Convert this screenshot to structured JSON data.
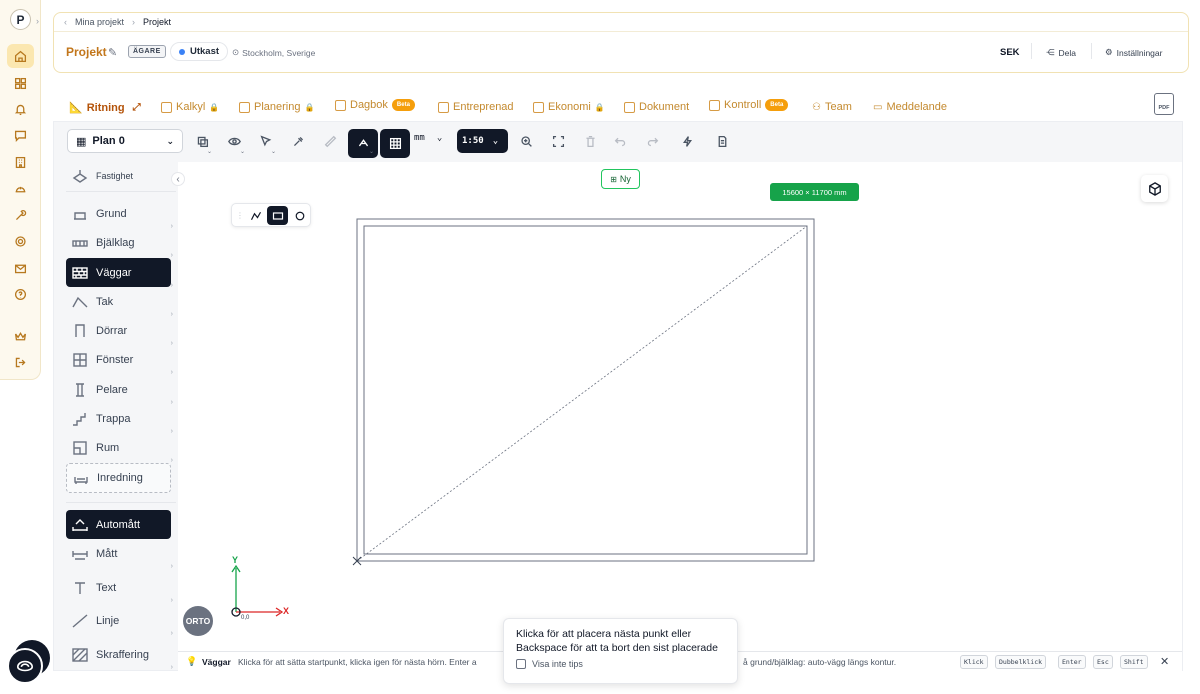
{
  "breadcrumb": {
    "back": "Mina projekt",
    "current": "Projekt"
  },
  "project": {
    "title": "Projekt",
    "owner_badge": "ÄGARE",
    "status": "Utkast",
    "location": "Stockholm, Sverige",
    "currency": "SEK",
    "share_label": "Dela",
    "settings_label": "Inställningar"
  },
  "tabs": [
    {
      "label": "Ritning",
      "active": true
    },
    {
      "label": "Kalkyl",
      "locked": true
    },
    {
      "label": "Planering",
      "locked": true
    },
    {
      "label": "Dagbok",
      "badge": "Beta"
    },
    {
      "label": "Entreprenad"
    },
    {
      "label": "Ekonomi",
      "locked": true
    },
    {
      "label": "Dokument"
    },
    {
      "label": "Kontroll",
      "badge": "Beta"
    },
    {
      "label": "Team"
    },
    {
      "label": "Meddelande"
    }
  ],
  "pdf_label": "PDF",
  "toolbar": {
    "plan_label": "Plan 0",
    "unit": "mm",
    "scale": "1:50"
  },
  "tools": {
    "site": "Fastighet",
    "items": [
      "Grund",
      "Bjälklag",
      "Väggar",
      "Tak",
      "Dörrar",
      "Fönster",
      "Pelare",
      "Trappa",
      "Rum",
      "Inredning"
    ],
    "measure": [
      "Automått",
      "Mått",
      "Text",
      "Linje",
      "Skraffering"
    ]
  },
  "canvas": {
    "new_label": "Ny",
    "dimension_label": "15600 × 11700 mm",
    "axis_x": "X",
    "axis_y": "Y",
    "origin": "0,0",
    "ortho": "ORTO"
  },
  "status": {
    "tool": "Väggar",
    "hint_left": "Klicka för att sätta startpunkt, klicka igen för nästa hörn. Enter a",
    "hint_right": "å grund/bjälklag: auto-vägg längs kontur.",
    "keys": [
      "Klick",
      "Dubbelklick",
      "Enter",
      "Esc",
      "Shift"
    ]
  },
  "tip": {
    "line1": "Klicka för att placera nästa punkt eller",
    "line2": "Backspace för att ta bort den sist placerade",
    "checkbox_label": "Visa inte tips"
  },
  "colors": {
    "accent": "#c2761b",
    "dimension_badge": "#16a34a",
    "dark": "#111827"
  }
}
